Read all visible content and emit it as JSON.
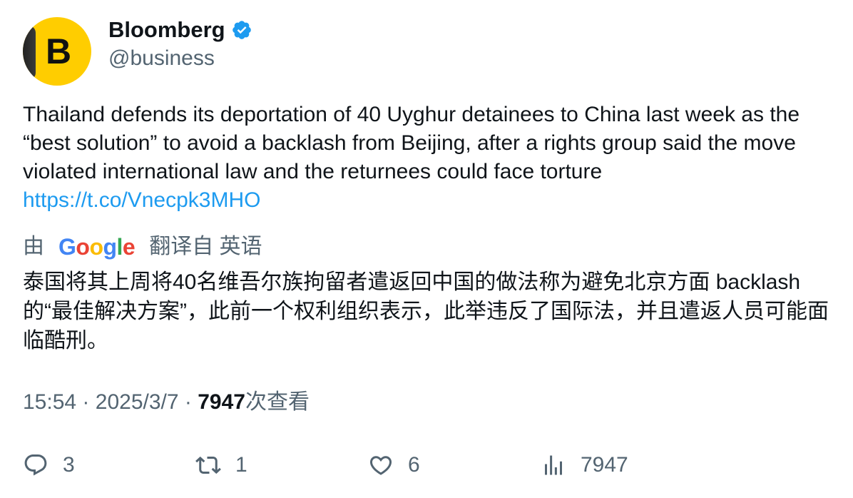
{
  "author": {
    "display_name": "Bloomberg",
    "handle": "@business",
    "avatar_letter": "B",
    "verified": true,
    "avatar_color": "#ffcd00"
  },
  "tweet": {
    "text": "Thailand defends its deportation of 40 Uyghur detainees to China last week as the “best solution” to avoid a backlash from Beijing, after a rights group said the move violated international law and the returnees could face torture",
    "link": "https://t.co/Vnecpk3MHO"
  },
  "translation": {
    "prefix": "由",
    "provider": "Google",
    "suffix": "翻译自 英语",
    "text": "泰国将其上周将40名维吾尔族拘留者遣返回中国的做法称为避免北京方面 backlash 的“最佳解决方案”，此前一个权利组织表示，此举违反了国际法，并且遣返人员可能面临酷刑。"
  },
  "meta": {
    "time": "15:54",
    "separator": "·",
    "date": "2025/3/7",
    "views": "7947",
    "views_label": "次查看"
  },
  "actions": {
    "replies": "3",
    "retweets": "1",
    "likes": "6",
    "views": "7947"
  },
  "colors": {
    "link": "#1d9bf0",
    "secondary_text": "#536471",
    "primary_text": "#0f1419",
    "verified": "#1d9bf0"
  }
}
